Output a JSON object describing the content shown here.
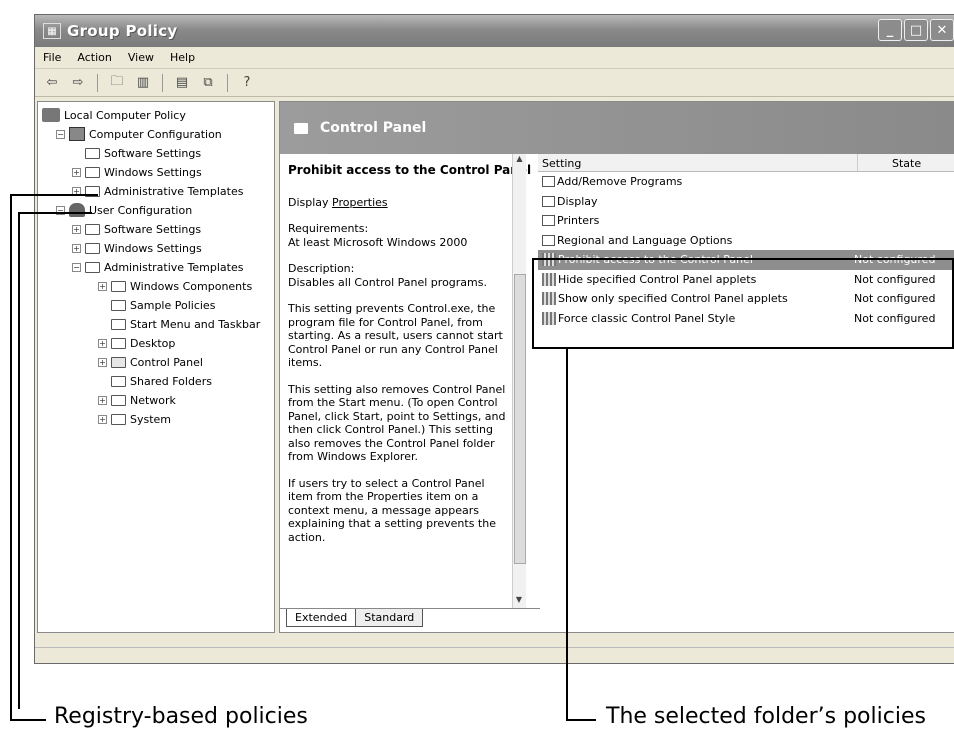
{
  "window": {
    "title": "Group Policy"
  },
  "menu": [
    "File",
    "Action",
    "View",
    "Help"
  ],
  "toolbar_icons": [
    "back-icon",
    "forward-icon",
    "up-folder-icon",
    "show-hide-tree-icon",
    "properties-icon",
    "export-list-icon",
    "help-icon"
  ],
  "tree": [
    {
      "label": "Local Computer Policy",
      "level": 0,
      "icon": "policy-root-icon"
    },
    {
      "label": "Computer Configuration",
      "level": 1,
      "icon": "computer-icon",
      "expander": "−"
    },
    {
      "label": "Software Settings",
      "level": 2,
      "icon": "folder-icon"
    },
    {
      "label": "Windows Settings",
      "level": 2,
      "icon": "folder-icon",
      "expander": "+"
    },
    {
      "label": "Administrative Templates",
      "level": 2,
      "icon": "folder-icon",
      "expander": "+"
    },
    {
      "label": "User Configuration",
      "level": 1,
      "icon": "user-icon",
      "expander": "−"
    },
    {
      "label": "Software Settings",
      "level": 2,
      "icon": "folder-icon",
      "expander": "+"
    },
    {
      "label": "Windows Settings",
      "level": 2,
      "icon": "folder-icon",
      "expander": "+"
    },
    {
      "label": "Administrative Templates",
      "level": 2,
      "icon": "folder-icon",
      "expander": "−"
    },
    {
      "label": "Windows Components",
      "level": 3,
      "icon": "folder-icon",
      "expander": "+"
    },
    {
      "label": "Sample Policies",
      "level": 3,
      "icon": "folder-icon"
    },
    {
      "label": "Start Menu and Taskbar",
      "level": 3,
      "icon": "folder-icon"
    },
    {
      "label": "Desktop",
      "level": 3,
      "icon": "folder-icon",
      "expander": "+"
    },
    {
      "label": "Control Panel",
      "level": 3,
      "icon": "open-folder-icon",
      "expander": "+"
    },
    {
      "label": "Shared Folders",
      "level": 3,
      "icon": "folder-icon"
    },
    {
      "label": "Network",
      "level": 3,
      "icon": "folder-icon",
      "expander": "+"
    },
    {
      "label": "System",
      "level": 3,
      "icon": "folder-icon",
      "expander": "+"
    }
  ],
  "right_header": "Control Panel",
  "description": {
    "title": "Prohibit access to the Control Panel",
    "display_prefix": "Display",
    "display_link": "Properties",
    "requirements_label": "Requirements:",
    "requirements_text": "At least Microsoft Windows 2000",
    "desc_label": "Description:",
    "desc_text": "Disables all Control Panel programs.",
    "para1": "This setting prevents Control.exe, the program file for Control Panel, from starting. As a result, users cannot start Control Panel or run any Control Panel items.",
    "para2": "This setting also removes Control Panel from the Start menu. (To open Control Panel, click Start, point to Settings, and then click Control Panel.) This setting also removes the Control Panel folder from Windows Explorer.",
    "para3": "If users try to select a Control Panel item from the Properties item on a context menu, a message appears explaining that a setting prevents the action."
  },
  "tabs": [
    "Extended",
    "Standard"
  ],
  "list": {
    "columns": [
      "Setting",
      "State"
    ],
    "rows": [
      {
        "setting": "Add/Remove Programs",
        "state": "",
        "type": "folder"
      },
      {
        "setting": "Display",
        "state": "",
        "type": "folder"
      },
      {
        "setting": "Printers",
        "state": "",
        "type": "folder"
      },
      {
        "setting": "Regional and Language Options",
        "state": "",
        "type": "folder"
      },
      {
        "setting": "Prohibit access to the Control Panel",
        "state": "Not configured",
        "type": "policy",
        "selected": true
      },
      {
        "setting": "Hide specified Control Panel applets",
        "state": "Not configured",
        "type": "policy"
      },
      {
        "setting": "Show only specified Control Panel applets",
        "state": "Not configured",
        "type": "policy"
      },
      {
        "setting": "Force classic Control Panel Style",
        "state": "Not configured",
        "type": "policy"
      }
    ]
  },
  "callouts": {
    "left": "Registry-based policies",
    "right": "The selected folder’s policies"
  }
}
